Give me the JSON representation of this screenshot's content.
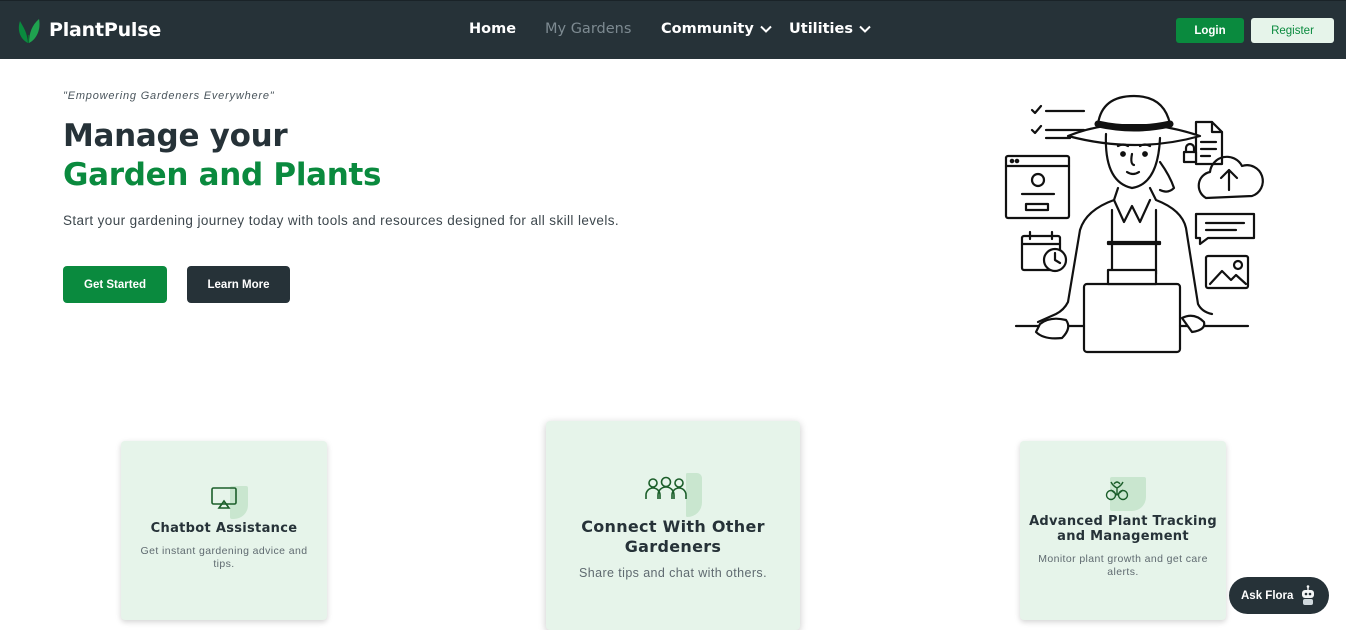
{
  "brand": {
    "name": "PlantPulse",
    "icon": "leaf-logo-icon",
    "accent": "#0a8a3e"
  },
  "nav": {
    "links": [
      {
        "label": "Home",
        "active": true
      },
      {
        "label": "My Gardens",
        "muted": true
      },
      {
        "label": "Community",
        "dropdown": true
      },
      {
        "label": "Utilities",
        "dropdown": true
      }
    ],
    "login_label": "Login",
    "register_label": "Register"
  },
  "hero": {
    "tagline": "\"Empowering Gardeners Everywhere\"",
    "title_line1": "Manage your",
    "title_line2": "Garden and Plants",
    "description": "Start your gardening journey today with tools and resources designed for all skill levels.",
    "primary_button": "Get Started",
    "secondary_button": "Learn More",
    "illustration": "gardener-at-laptop-illustration"
  },
  "features": [
    {
      "icon": "chatbot-screen-icon",
      "title": "Chatbot Assistance",
      "description": "Get instant gardening advice and tips."
    },
    {
      "icon": "community-group-icon",
      "title": "Connect With Other Gardeners",
      "description": "Share tips and chat with others."
    },
    {
      "icon": "plant-tracking-icon",
      "title": "Advanced Plant Tracking and Management",
      "description": "Monitor plant growth and get care alerts."
    }
  ],
  "chat_widget": {
    "label": "Ask Flora",
    "icon": "robot-icon"
  },
  "colors": {
    "navbar": "#263238",
    "primary": "#0a8a3e",
    "card_bg": "#e6f4ea",
    "register_bg": "#e6f4ea"
  }
}
